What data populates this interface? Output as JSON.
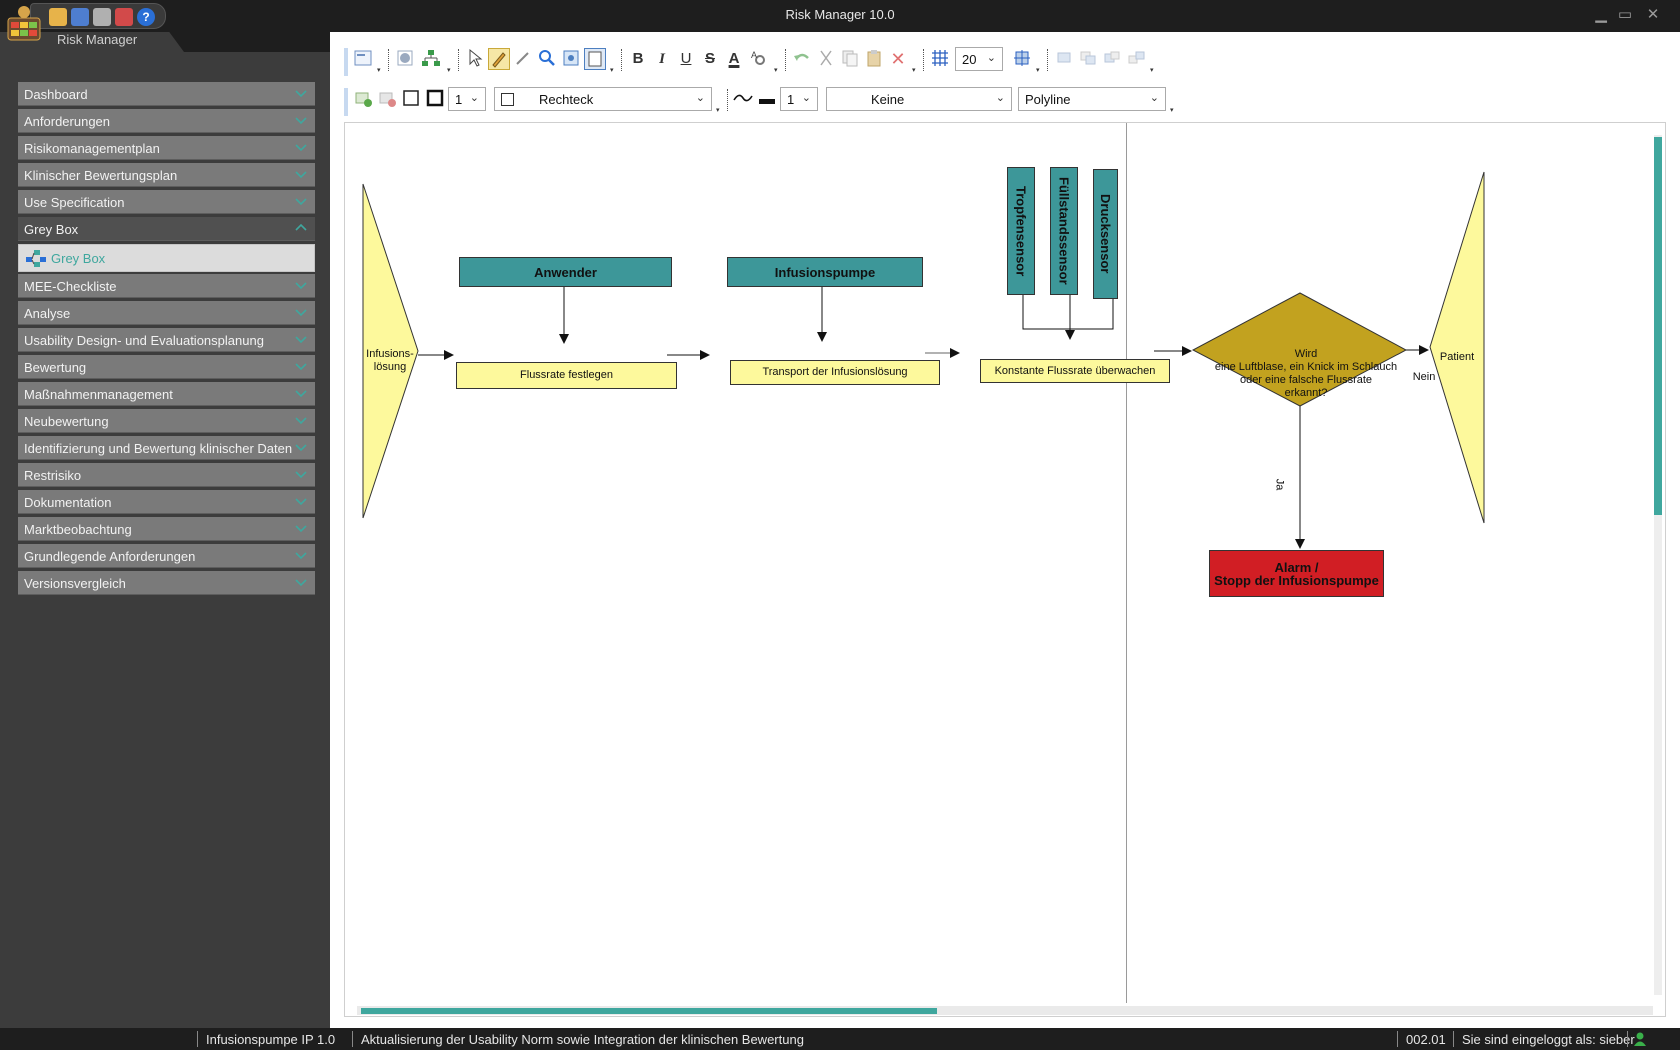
{
  "window": {
    "title": "Risk Manager   10.0",
    "app_name": "Risk Manager",
    "controls": {
      "minimize": "▁",
      "maximize": "▭",
      "close": "✕"
    }
  },
  "quickbar": {
    "icons": [
      "package-icon",
      "export-icon",
      "tools-icon",
      "spellcheck-icon",
      "help-icon"
    ],
    "help_label": "?"
  },
  "sidebar": {
    "items": [
      {
        "label": "Dashboard"
      },
      {
        "label": "Anforderungen"
      },
      {
        "label": "Risikomanagementplan"
      },
      {
        "label": "Klinischer Bewertungsplan"
      },
      {
        "label": "Use Specification"
      },
      {
        "label": "Grey Box",
        "expanded": true
      },
      {
        "label": "MEE-Checkliste"
      },
      {
        "label": "Analyse"
      },
      {
        "label": "Usability Design- und Evaluationsplanung"
      },
      {
        "label": "Bewertung"
      },
      {
        "label": "Maßnahmenmanagement"
      },
      {
        "label": "Neubewertung"
      },
      {
        "label": "Identifizierung und Bewertung klinischer Daten"
      },
      {
        "label": "Restrisiko"
      },
      {
        "label": "Dokumentation"
      },
      {
        "label": "Marktbeobachtung"
      },
      {
        "label": "Grundlegende Anforderungen"
      },
      {
        "label": "Versionsvergleich"
      }
    ],
    "sub_item": {
      "label": "Grey Box"
    }
  },
  "toolbar": {
    "row1": {
      "text_format": {
        "bold": "B",
        "italic": "I",
        "underline": "U",
        "strike": "S",
        "font_color": "A"
      },
      "grid_size": "20"
    },
    "row2": {
      "border_width": "1",
      "shape": "Rechteck",
      "line_width": "1",
      "arrow": "Keine",
      "connector": "Polyline"
    }
  },
  "diagram": {
    "colors": {
      "teal": "#3d9799",
      "yellow": "#fdf99c",
      "decision": "#c2a21f",
      "alarm": "#d11e24"
    },
    "source_label": "Infusions-\nlösung",
    "actor_user": "Anwender",
    "actor_pump": "Infusionspumpe",
    "sensors": [
      "Tropfensensor",
      "Füllstandssensor",
      "Drucksensor"
    ],
    "steps": [
      "Flussrate festlegen",
      "Transport der Infusionslösung",
      "Konstante Flussrate überwachen"
    ],
    "decision": "Wird\neine Luftblase, ein Knick im Schlauch\noder eine falsche Flussrate\nerkannt?",
    "label_no": "Nein",
    "label_yes": "Ja",
    "alarm": "Alarm /\nStopp der Infusionspumpe",
    "target_label": "Patient"
  },
  "status": {
    "project": "Infusionspumpe IP 1.0",
    "description": "Aktualisierung der Usability Norm sowie Integration der klinischen Bewertung",
    "version": "002.01",
    "user": "Sie sind eingeloggt als: sieber"
  }
}
